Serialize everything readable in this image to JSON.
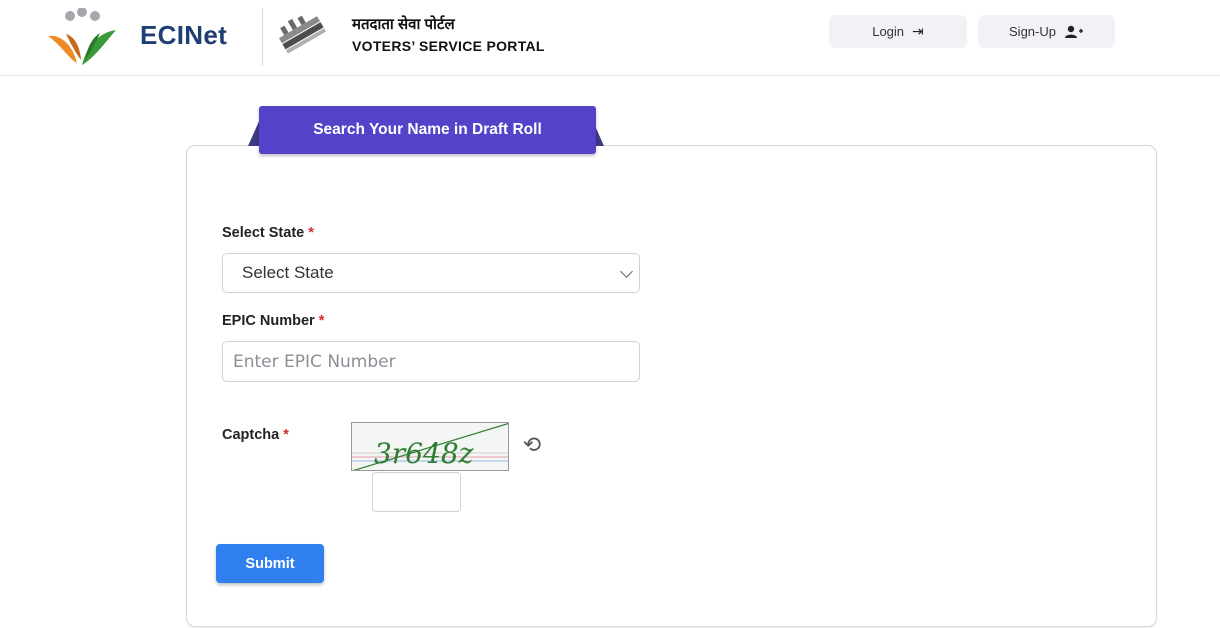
{
  "header": {
    "brand_name": "ECINet",
    "portal_name_hindi": "मतदाता सेवा पोर्टल",
    "portal_name_english": "VOTERS’ SERVICE PORTAL",
    "login_label": "Login",
    "login_icon": "login-arrow-icon",
    "signup_label": "Sign-Up",
    "signup_icon": "user-plus-icon"
  },
  "form": {
    "tab_title": "Search Your Name in Draft Roll",
    "state_label": "Select State",
    "state_selected": "Select State",
    "epic_label": "EPIC Number",
    "epic_placeholder": "Enter EPIC Number",
    "captcha_label": "Captcha",
    "required_mark": "*",
    "captcha_text": "3r648z",
    "submit_label": "Submit"
  },
  "colors": {
    "brand_blue": "#1f3e73",
    "tab_purple": "#5443c9",
    "submit_blue": "#2f80ee",
    "required_red": "#d62828",
    "captcha_green": "#2e7d32"
  }
}
